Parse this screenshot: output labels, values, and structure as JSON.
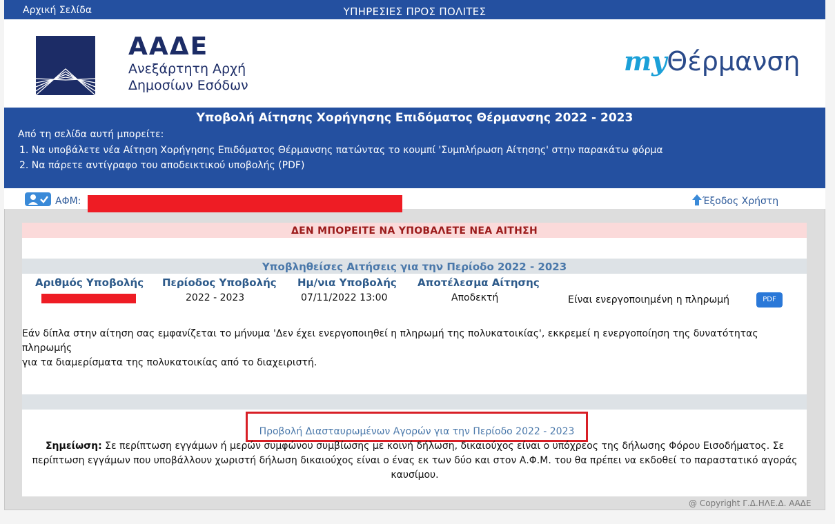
{
  "topbar": {
    "home": "Αρχική Σελίδα",
    "title": "ΥΠΗΡΕΣΙΕΣ ΠΡΟΣ ΠΟΛΙΤΕΣ"
  },
  "header": {
    "aade_abbr": "ΑΑΔΕ",
    "aade_line1": "Ανεξάρτητη Αρχή",
    "aade_line2": "Δημοσίων Εσόδων",
    "app_logo_my": "my",
    "app_logo_rest": "Θέρμανση"
  },
  "banner": {
    "title": "Υποβολή Αίτησης Χορήγησης Επιδόματος Θέρμανσης 2022 - 2023",
    "intro": "Από τη σελίδα αυτή μπορείτε:",
    "items": [
      "1. Να υποβάλετε νέα Αίτηση Χορήγησης Επιδόματος Θέρμανσης πατώντας το κουμπί 'Συμπλήρωση Αίτησης' στην παρακάτω φόρμα",
      "2. Να πάρετε αντίγραφο του αποδεικτικού υποβολής (PDF)"
    ]
  },
  "user": {
    "afm_label": "ΑΦΜ:",
    "logout": "Έξοδος Χρήστη"
  },
  "content": {
    "warning": "ΔΕΝ ΜΠΟΡΕΙΤΕ ΝΑ ΥΠΟΒΑΛΕΤΕ ΝΕΑ ΑΙΤΗΣΗ",
    "section_title": "Υποβληθείσες Αιτήσεις για την Περίοδο 2022 - 2023",
    "columns": [
      "Αριθμός Υποβολής",
      "Περίοδος Υποβολής",
      "Ημ/νια Υποβολής",
      "Αποτέλεσμα Αίτησης"
    ],
    "row": {
      "period": "2022 - 2023",
      "date": "07/11/2022 13:00",
      "result": "Αποδεκτή",
      "payment": "Είναι ενεργοποιημένη η πληρωμή",
      "pdf": "PDF"
    },
    "note_line1": "Εάν δίπλα στην αίτηση σας εμφανίζεται το μήνυμα 'Δεν έχει ενεργοποιηθεί η πληρωμή της πολυκατοικίας', εκκρεμεί η ενεργοποίηση της δυνατότητας πληρωμής",
    "note_line2": "για τα διαμερίσματα της πολυκατοικίας από το διαχειριστή.",
    "purchases_link": "Προβολή Διασταυρωμένων Αγορών για την Περίοδο 2022 - 2023",
    "footnote_label": "Σημείωση:",
    "footnote_text1": " Σε περίπτωση εγγάμων ή μερών συμφώνου συμβίωσης με κοινή δήλωση, δικαιούχος είναι ο υπόχρεος της δήλωσης Φόρου Εισοδήματος. Σε",
    "footnote_text2": "περίπτωση εγγάμων που υποβάλλουν χωριστή δήλωση δικαιούχος είναι ο ένας εκ των δύο και στον Α.Φ.Μ. του θα πρέπει να εκδοθεί το παραστατικό αγοράς",
    "footnote_text3": "καυσίμου."
  },
  "footer": {
    "copyright": "@ Copyright Γ.Δ.ΗΛΕ.Δ. ΑΑΔΕ"
  },
  "colors": {
    "blue": "#2450a0",
    "redaction": "#ee1c24",
    "warning_bg": "#fbdada",
    "highlight_border": "#d81f26"
  }
}
